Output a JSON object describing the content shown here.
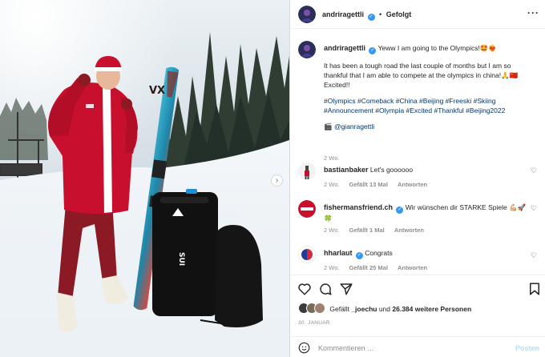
{
  "post": {
    "author": "andriragettli",
    "follow_label": "Gefolgt",
    "more_icon": "more-options-icon",
    "caption": {
      "line1": "Yeww I am going to the Olympics!🤩❤️‍🔥",
      "line2": "It has been a tough road the last couple of months but I am so thankful that I am able to compete at the olympics in china!🙏🇨🇳 Excited!!",
      "hashtags": "#Olympics #Comeback #China #Beijing #Freeski #Skiing #Announcement #Olympia #Excited #Thankful #Beijing2022",
      "credit": "🎬 @gianragettli",
      "time": "2 Wo."
    }
  },
  "comments": [
    {
      "user": "bastianbaker",
      "verified": false,
      "text": "Let's goooooo",
      "time": "2 Wo.",
      "likes": "Gefällt 13 Mal",
      "reply": "Antworten"
    },
    {
      "user": "fishermansfriend.ch",
      "verified": true,
      "text": "Wir wünschen dir STARKE Spiele 💪🏼🚀🍀",
      "time": "2 Wo.",
      "likes": "Gefällt 1 Mal",
      "reply": "Antworten"
    },
    {
      "user": "hharlaut",
      "verified": true,
      "text": "Congrats",
      "time": "2 Wo.",
      "likes": "Gefällt 25 Mal",
      "reply": "Antworten"
    }
  ],
  "likes": {
    "prefix": "Gefällt",
    "first_user": "_joechu",
    "connector": "und",
    "count": "26.384 weitere Personen"
  },
  "date": "30. JANUAR",
  "composer": {
    "placeholder": "Kommentieren …",
    "post_label": "Posten"
  },
  "photo": {
    "bag_text": "SUI",
    "ski_text": "VX"
  },
  "colors": {
    "accent": "#3897f0",
    "link": "#00376b",
    "jacket": "#c8102e",
    "meta": "#8e8e8e"
  }
}
